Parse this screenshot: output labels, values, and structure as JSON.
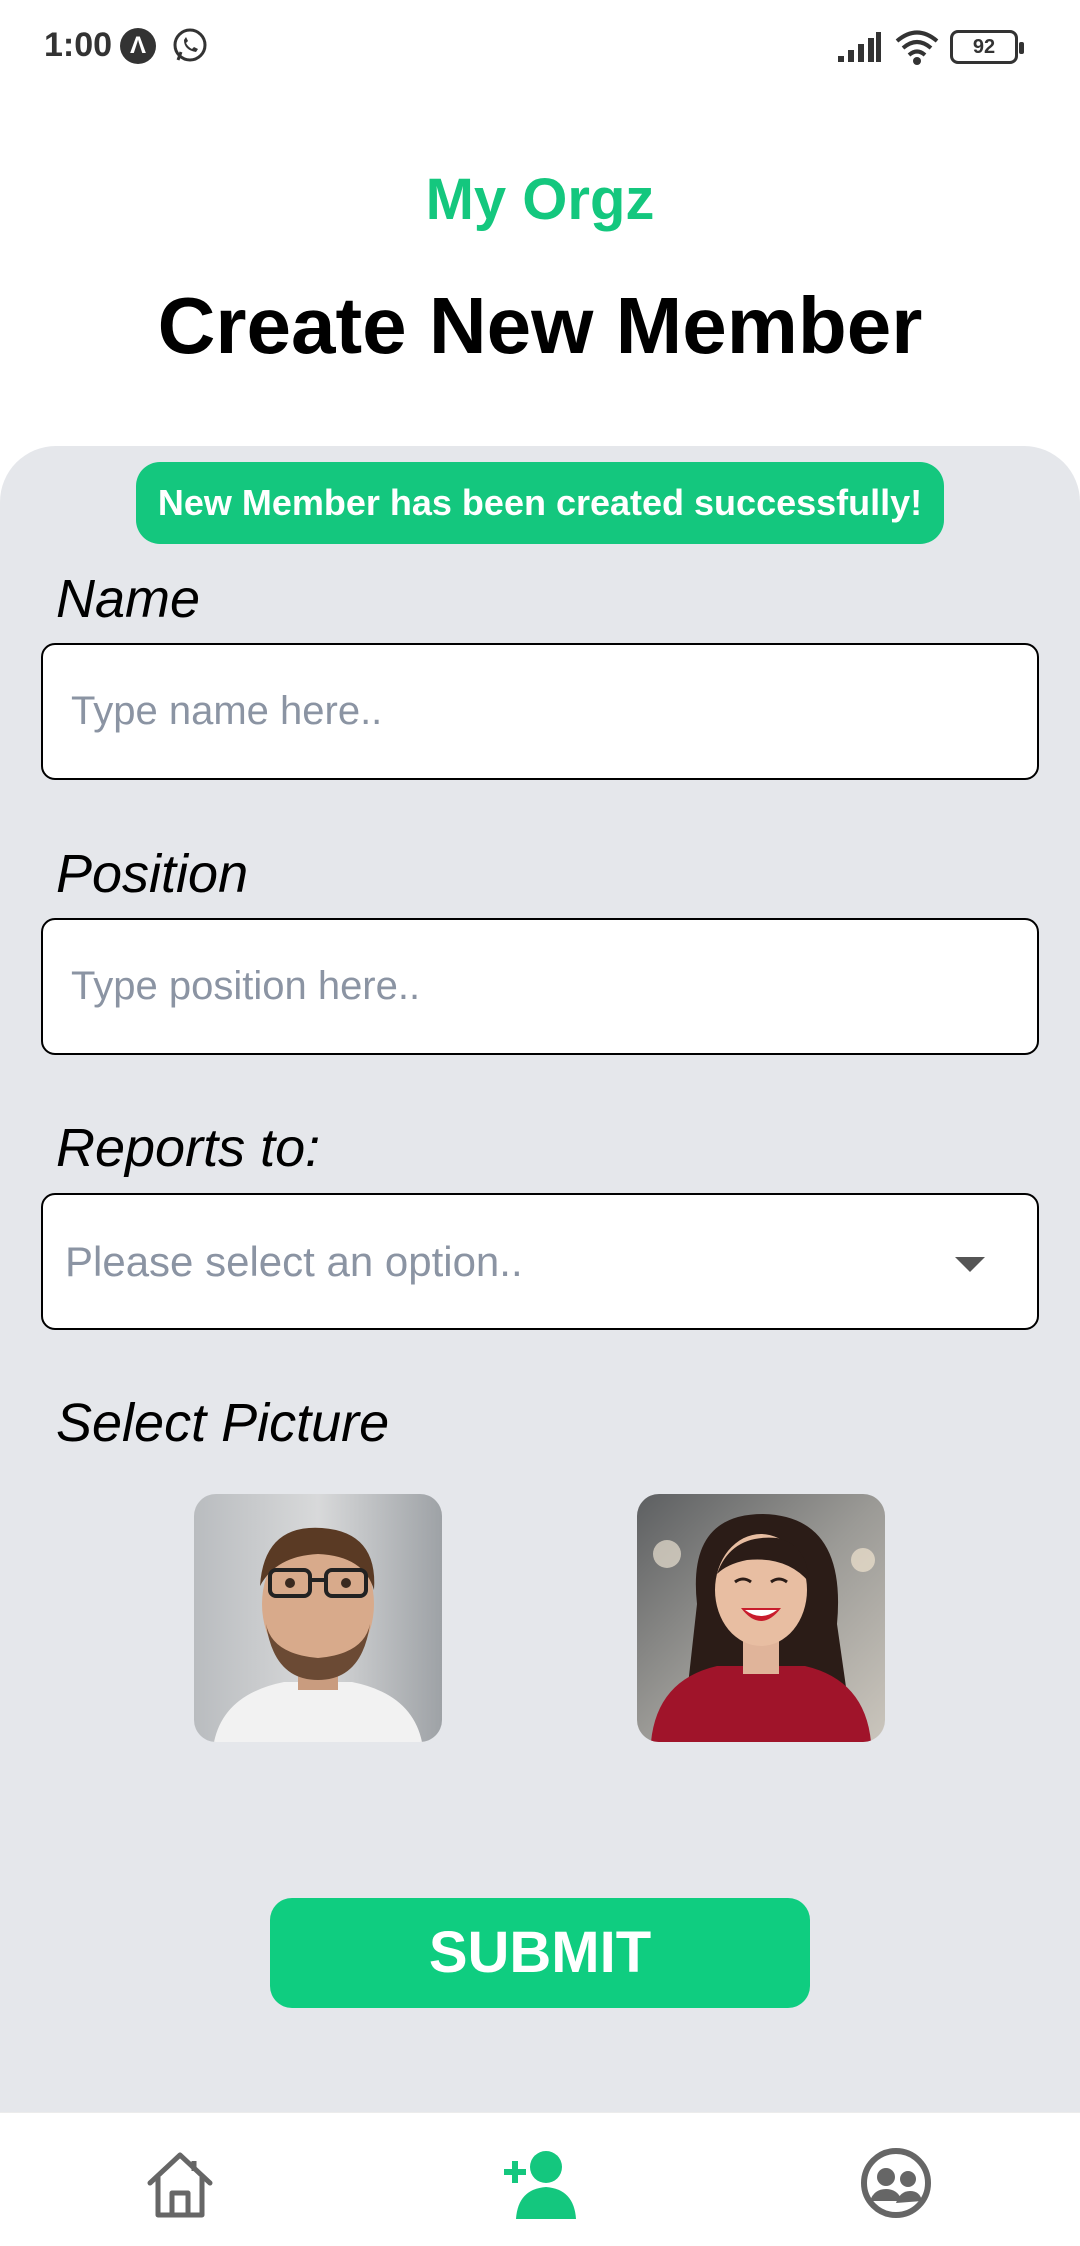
{
  "status_bar": {
    "time": "1:00",
    "battery": "92",
    "icons": [
      "a-notification-icon",
      "whatsapp-icon",
      "signal-icon",
      "wifi-icon",
      "battery-icon"
    ]
  },
  "header": {
    "app_title": "My Orgz",
    "page_title": "Create New Member"
  },
  "toast": {
    "message": "New Member has been created successfully!"
  },
  "form": {
    "name": {
      "label": "Name",
      "placeholder": "Type name here..",
      "value": ""
    },
    "position": {
      "label": "Position",
      "placeholder": "Type position here..",
      "value": ""
    },
    "reports_to": {
      "label": "Reports to:",
      "placeholder": "Please select an option..",
      "value": ""
    },
    "picture": {
      "label": "Select Picture",
      "options": [
        "man-avatar-photo",
        "woman-avatar-photo"
      ]
    },
    "submit_label": "SUBMIT"
  },
  "bottom_nav": {
    "items": [
      {
        "icon": "home-icon",
        "active": false
      },
      {
        "icon": "add-user-icon",
        "active": true
      },
      {
        "icon": "team-icon",
        "active": false
      }
    ]
  },
  "colors": {
    "accent": "#14c77e",
    "card_background": "#e5e7eb",
    "placeholder": "#8b94a3"
  }
}
